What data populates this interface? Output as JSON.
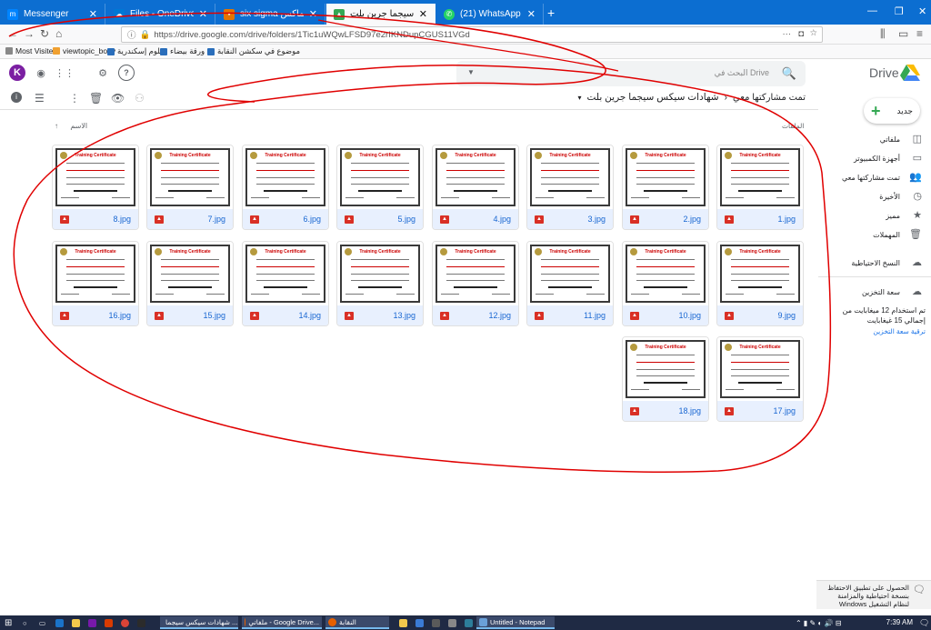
{
  "tabs": [
    {
      "label": "Messenger",
      "color": "#0084ff",
      "active": false
    },
    {
      "label": "Files - OneDrive",
      "color": "#0078d4",
      "active": false
    },
    {
      "label": "six sigma الماكس",
      "color": "#e37400",
      "active": false
    },
    {
      "label": "شهادات سيكس سيجما جرين بلت",
      "color": "#34a853",
      "active": true
    },
    {
      "label": "(21) WhatsApp",
      "color": "#25d366",
      "active": false
    }
  ],
  "nav": {
    "url": "https://drive.google.com/drive/folders/1Tic1uWQwLFSD97e2rIKNDupCGUS11VGd"
  },
  "bookmarks": [
    {
      "label": "Most Visited",
      "color": "#888888"
    },
    {
      "label": "viewtopic_body",
      "color": "#f0a030"
    },
    {
      "label": "علوم إسكندرية",
      "color": "#2a6ebb"
    },
    {
      "label": "ورقة بيضاء",
      "color": "#2a6ebb"
    },
    {
      "label": "موضوع في سكشن النقابة",
      "color": "#2a6ebb"
    }
  ],
  "header": {
    "avatar_letter": "K",
    "search_placeholder": "البحث في Drive",
    "app_name": "Drive"
  },
  "breadcrumb": {
    "parent": "تمت مشاركتها معي",
    "current": "شهادات سيكس سيجما جرين بلت"
  },
  "content": {
    "files_label": "الملفات",
    "sort_label": "الاسم",
    "files": [
      "1.jpg",
      "2.jpg",
      "3.jpg",
      "4.jpg",
      "5.jpg",
      "6.jpg",
      "7.jpg",
      "8.jpg",
      "9.jpg",
      "10.jpg",
      "11.jpg",
      "12.jpg",
      "13.jpg",
      "14.jpg",
      "15.jpg",
      "16.jpg",
      "17.jpg",
      "18.jpg"
    ],
    "cert_title": "Training Certificate"
  },
  "sidebar": {
    "new_label": "جديد",
    "items": [
      {
        "label": "ملفاتي",
        "icon": "drive-icon"
      },
      {
        "label": "أجهزة الكمبيوتر",
        "icon": "computer-icon"
      },
      {
        "label": "تمت مشاركتها معي",
        "icon": "people-icon"
      },
      {
        "label": "الأخيرة",
        "icon": "clock-icon"
      },
      {
        "label": "مميز",
        "icon": "star-icon"
      },
      {
        "label": "المهملات",
        "icon": "trash-icon"
      }
    ],
    "backup_label": "النسخ الاحتياطية",
    "storage_label": "سعة التخزين",
    "storage_text": "تم استخدام 12 ميغابايت من إجمالي 15 غيغابايت",
    "upgrade_label": "ترقية سعة التخزين"
  },
  "notification": {
    "text": "الحصول على تطبيق الاحتفاظ بنسخة احتياطية والمزامنة لنظام التشغيل Windows"
  },
  "taskbar": {
    "tasks": [
      {
        "label": "شهادات سيكس سيجما ...",
        "color": "#e66000"
      },
      {
        "label": "ملفاتي - Google Drive...",
        "color": "#e66000"
      },
      {
        "label": "النقابة",
        "color": "#e66000"
      },
      {
        "label": "Untitled - Notepad",
        "color": "#6aa0d8"
      }
    ],
    "clock": "7:39 AM"
  }
}
